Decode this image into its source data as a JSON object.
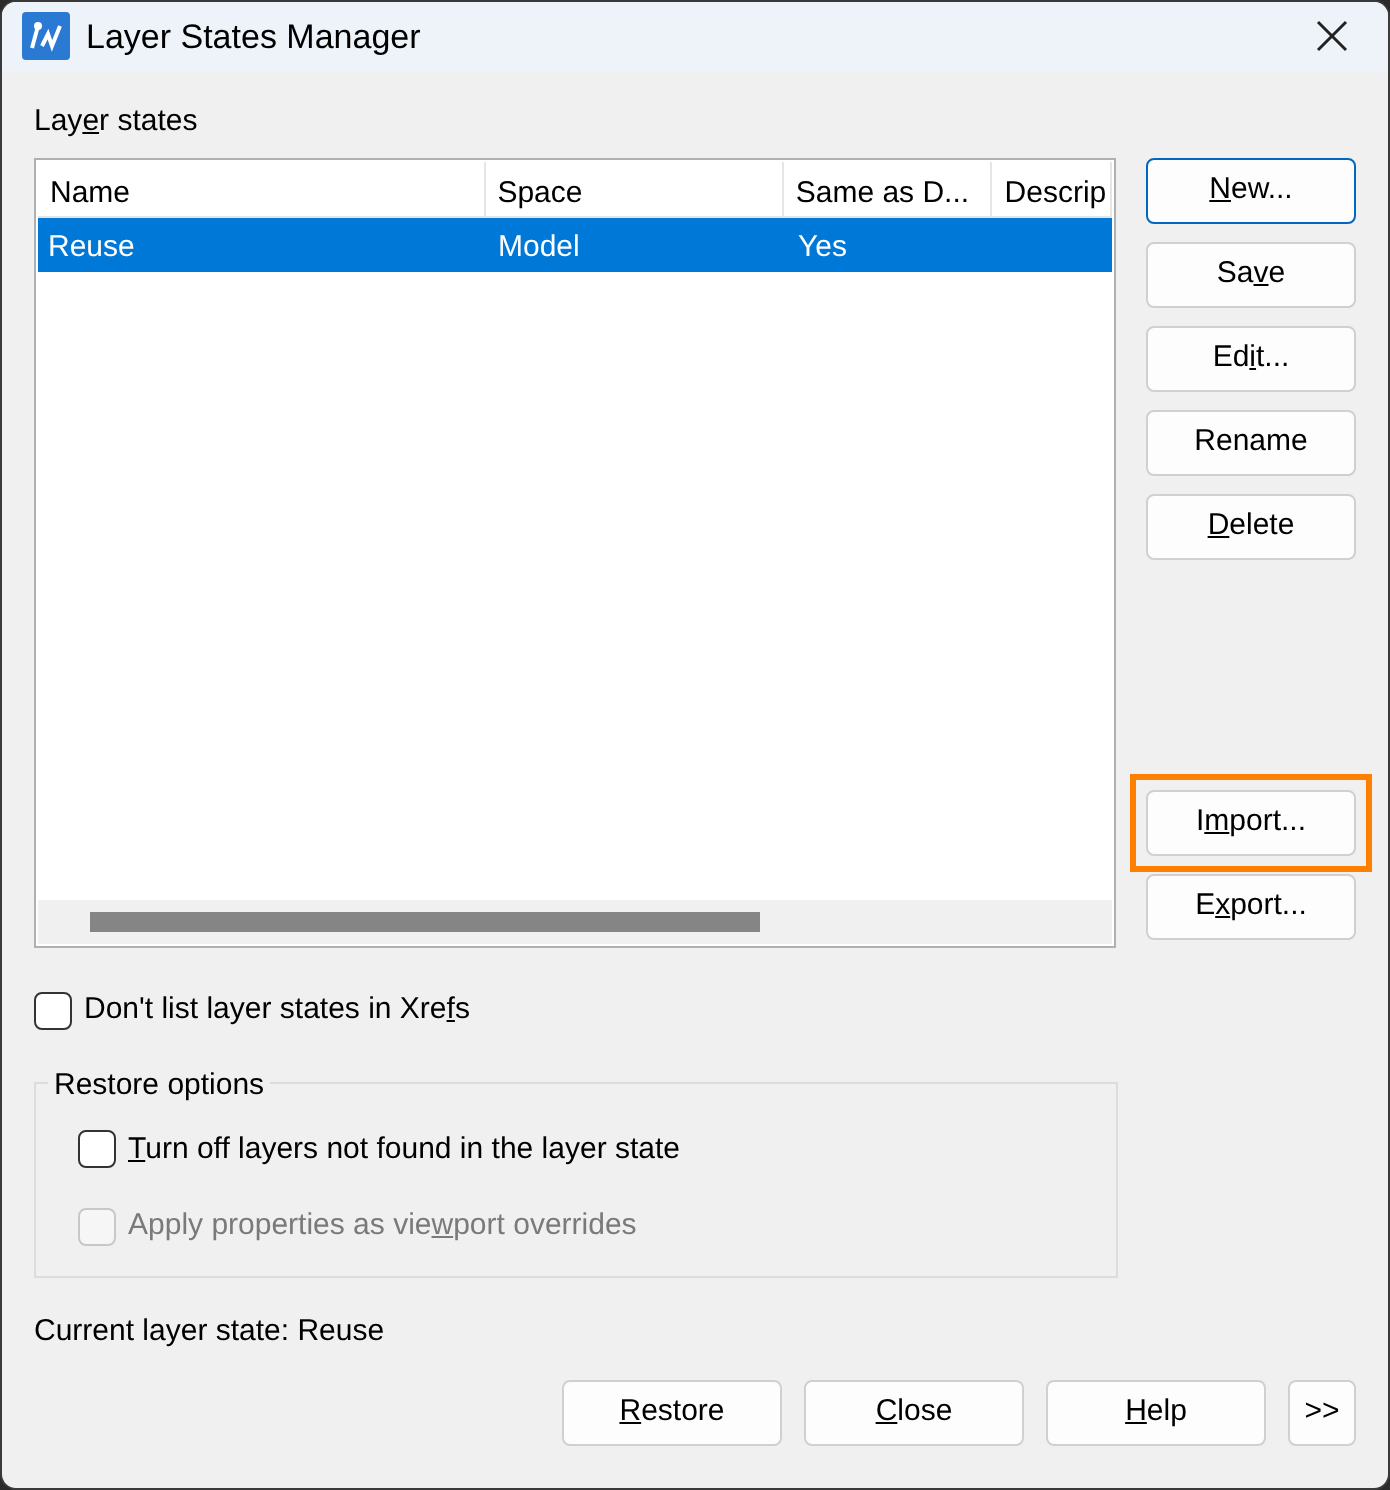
{
  "window": {
    "title": "Layer States Manager"
  },
  "list_label": {
    "before": "Lay",
    "access_key": "e",
    "after": "r states"
  },
  "table": {
    "columns": [
      "Name",
      "Space",
      "Same as D...",
      "Descrip"
    ],
    "rows": [
      {
        "cells": [
          "Reuse",
          "Model",
          "Yes"
        ],
        "selected": true
      }
    ]
  },
  "side_buttons": [
    {
      "access_key": "N",
      "after": "ew...",
      "focused": true,
      "highlighted": false
    },
    {
      "before": "Sa",
      "access_key": "v",
      "after": "e",
      "focused": false,
      "highlighted": false
    },
    {
      "before": "Ed",
      "access_key": "i",
      "after": "t...",
      "focused": false,
      "highlighted": false
    },
    {
      "before": "Rename",
      "focused": false,
      "highlighted": false
    },
    {
      "access_key": "D",
      "after": "elete",
      "focused": false,
      "highlighted": false
    },
    {
      "before": "I",
      "access_key": "m",
      "after": "port...",
      "focused": false,
      "highlighted": true
    },
    {
      "before": "E",
      "access_key": "x",
      "after": "port...",
      "focused": false,
      "highlighted": false
    }
  ],
  "xrefs_checkbox": {
    "before": "Don't list layer states in Xre",
    "access_key": "f",
    "after": "s",
    "checked": false,
    "disabled": false
  },
  "restore_options": {
    "title": "Restore options",
    "options": [
      {
        "access_key": "T",
        "after": "urn off layers not found in the layer state",
        "checked": false,
        "disabled": false
      },
      {
        "before": "Apply properties as vie",
        "access_key": "w",
        "after": "port overrides",
        "checked": false,
        "disabled": true
      }
    ]
  },
  "current_state": "Current layer state: Reuse",
  "bottom_buttons": [
    {
      "access_key": "R",
      "after": "estore"
    },
    {
      "access_key": "C",
      "after": "lose"
    },
    {
      "access_key": "H",
      "after": "elp"
    },
    {
      "before": ">>"
    }
  ]
}
